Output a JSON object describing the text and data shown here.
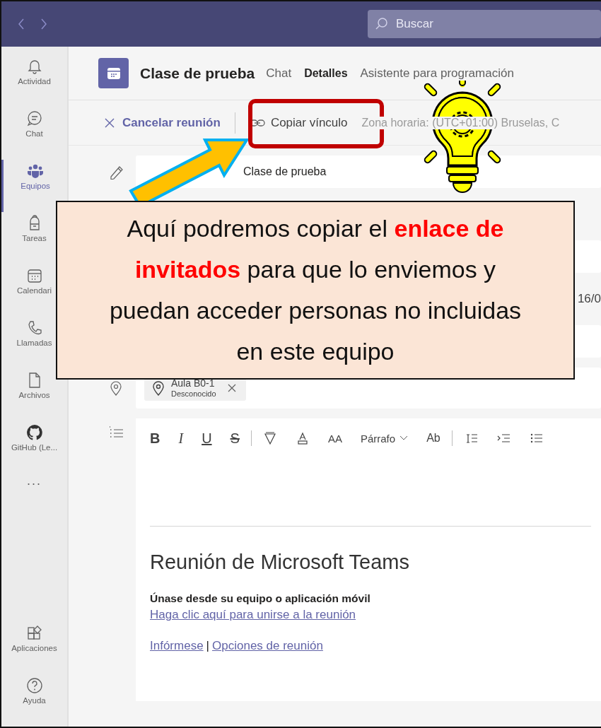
{
  "title_bar": {
    "search": {
      "placeholder": "Buscar"
    }
  },
  "rail": {
    "items": [
      {
        "label": "Actividad",
        "selected": false
      },
      {
        "label": "Chat",
        "selected": false
      },
      {
        "label": "Equipos",
        "selected": true
      },
      {
        "label": "Tareas",
        "selected": false
      },
      {
        "label": "Calendari",
        "selected": false
      },
      {
        "label": "Llamadas",
        "selected": false
      },
      {
        "label": "Archivos",
        "selected": false
      },
      {
        "label": "GitHub (Le...",
        "selected": false
      }
    ],
    "more": "...",
    "bottom_items": [
      {
        "label": "Aplicaciones",
        "selected": false
      },
      {
        "label": "Ayuda",
        "selected": false
      }
    ]
  },
  "meeting": {
    "title": "Clase de prueba",
    "tabs": [
      {
        "label": "Chat",
        "selected": false
      },
      {
        "label": "Detalles",
        "selected": true
      },
      {
        "label": "Asistente para programación",
        "selected": false
      }
    ]
  },
  "toolbar": {
    "cancel": "Cancelar reunión",
    "copy_link": "Copiar vínculo",
    "time_zone": "Zona horaria: (UTC+01:00) Bruselas, C"
  },
  "form": {
    "title_value": "Clase de prueba",
    "date_fragment": "16/0",
    "location_chip": {
      "name": "Aula B0-1",
      "status": "Desconocido"
    }
  },
  "editor": {
    "tools": [
      {
        "kind": "text",
        "label": "B"
      },
      {
        "kind": "text",
        "label": "I"
      },
      {
        "kind": "text",
        "label": "U"
      },
      {
        "kind": "text",
        "label": "S"
      },
      {
        "kind": "separator"
      },
      {
        "kind": "icon"
      },
      {
        "kind": "icon"
      },
      {
        "kind": "text",
        "label": "AA"
      },
      {
        "kind": "dropdown",
        "label": "Párrafo"
      },
      {
        "kind": "text",
        "label": "Ab"
      },
      {
        "kind": "separator"
      },
      {
        "kind": "icon"
      },
      {
        "kind": "icon"
      },
      {
        "kind": "icon"
      }
    ],
    "heading": "Reunión de Microsoft Teams",
    "join_label": "Únase desde su equipo o aplicación móvil",
    "join_link": "Haga clic aquí para unirse a la reunión",
    "links": [
      "Infórmese",
      "Opciones de reunión"
    ],
    "link_separator": "|"
  },
  "callout": {
    "text": "Aquí podremos copiar el **enlace de invitados** para que lo enviemos y puedan acceder personas no incluidas en este equipo"
  }
}
